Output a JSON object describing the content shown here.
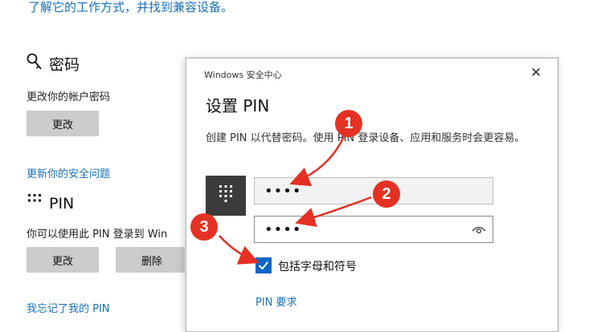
{
  "settings": {
    "top_text": "了解它的工作方式，并找到兼容设备。",
    "password": {
      "title": "密码",
      "desc": "更改你的帐户密码",
      "change_label": "更改"
    },
    "security_link": "更新你的安全问题",
    "pin": {
      "title": "PIN",
      "desc": "你可以使用此 PIN 登录到 Win",
      "change_label": "更改",
      "delete_label": "删除"
    },
    "forgot_link": "我忘记了我的 PIN"
  },
  "dialog": {
    "caption": "Windows 安全中心",
    "title": "设置 PIN",
    "description": "创建 PIN 以代替密码。使用 PIN 登录设备、应用和服务时会更容易。",
    "pin_value": "••••",
    "confirm_value": "••••",
    "checkbox_label": "包括字母和符号",
    "checkbox_checked": true,
    "pin_requirements_link": "PIN 要求"
  },
  "annotations": {
    "badge1": "1",
    "badge2": "2",
    "badge3": "3",
    "color": "#e53124"
  },
  "colors": {
    "link": "#1a6fb8",
    "accent": "#0a64c8",
    "button": "#cccccc"
  }
}
